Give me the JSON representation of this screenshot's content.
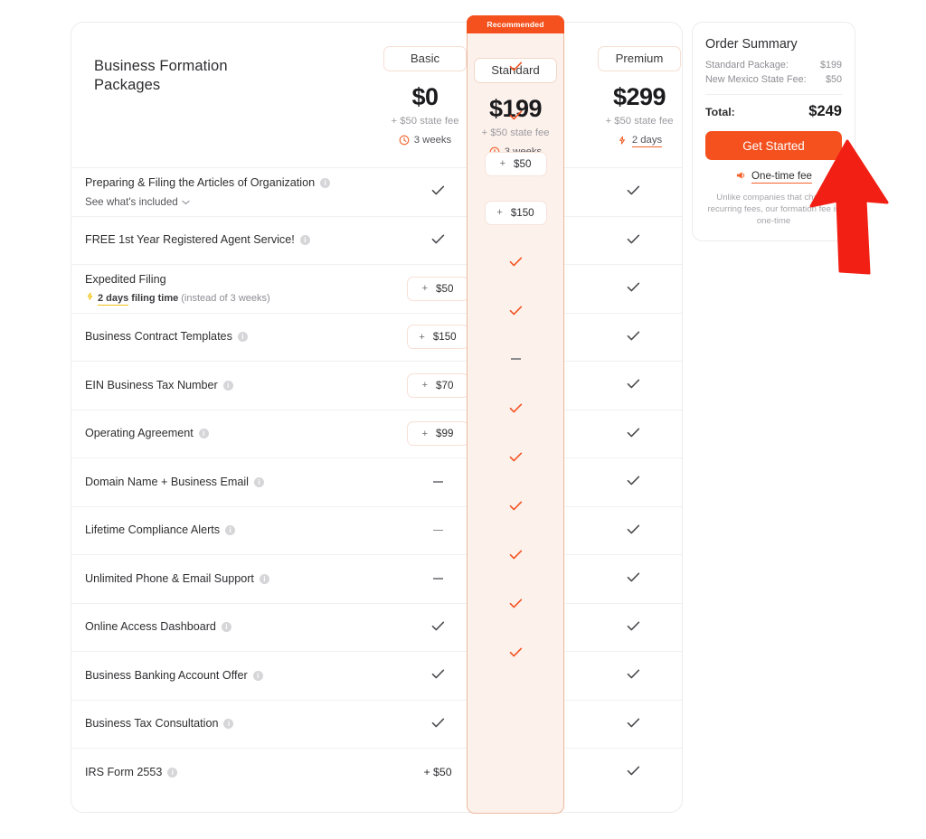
{
  "card": {
    "title": "Business Formation\nPackages",
    "title_line1": "Business Formation",
    "title_line2": "Packages"
  },
  "plans": [
    {
      "key": "basic",
      "name": "Basic",
      "price": "$0",
      "state_fee_note": "+ $50 state fee",
      "turnaround": "3 weeks",
      "turnaround_icon": "clock-icon",
      "recommended": false,
      "badge": ""
    },
    {
      "key": "standard",
      "name": "Standard",
      "price": "$199",
      "state_fee_note": "+ $50 state fee",
      "turnaround": "3 weeks",
      "turnaround_icon": "clock-icon",
      "recommended": true,
      "badge": "Recommended"
    },
    {
      "key": "premium",
      "name": "Premium",
      "price": "$299",
      "state_fee_note": "+ $50 state fee",
      "turnaround": "2 days",
      "turnaround_icon": "lightning-icon",
      "recommended": false,
      "badge": ""
    }
  ],
  "features": [
    {
      "label": "Preparing & Filing the Articles of Organization",
      "info": true,
      "sub_link": "See what's included",
      "sub_link_icon": "chevron-down-icon",
      "basic": {
        "type": "check"
      },
      "standard": {
        "type": "check"
      },
      "premium": {
        "type": "check"
      }
    },
    {
      "label": "FREE 1st Year Registered Agent Service!",
      "info": true,
      "basic": {
        "type": "check"
      },
      "standard": {
        "type": "check"
      },
      "premium": {
        "type": "check"
      }
    },
    {
      "label": "Expedited Filing",
      "info": false,
      "sub_note_icon": "lightning-icon",
      "sub_note_bold": "2 days",
      "sub_note_bold_tail": " filing time",
      "sub_note_muted": "(instead of 3 weeks)",
      "basic": {
        "type": "addon",
        "plus": "+",
        "price": "$50"
      },
      "standard": {
        "type": "addon",
        "plus": "+",
        "price": "$50"
      },
      "premium": {
        "type": "check"
      }
    },
    {
      "label": "Business Contract Templates",
      "info": true,
      "basic": {
        "type": "addon",
        "plus": "+",
        "price": "$150"
      },
      "standard": {
        "type": "addon",
        "plus": "+",
        "price": "$150"
      },
      "premium": {
        "type": "check"
      }
    },
    {
      "label": "EIN Business Tax Number",
      "info": true,
      "basic": {
        "type": "addon",
        "plus": "+",
        "price": "$70"
      },
      "standard": {
        "type": "check"
      },
      "premium": {
        "type": "check"
      }
    },
    {
      "label": "Operating Agreement",
      "info": true,
      "basic": {
        "type": "addon",
        "plus": "+",
        "price": "$99"
      },
      "standard": {
        "type": "check"
      },
      "premium": {
        "type": "check"
      }
    },
    {
      "label": "Domain Name + Business Email",
      "info": true,
      "basic": {
        "type": "dash"
      },
      "standard": {
        "type": "dash"
      },
      "premium": {
        "type": "check"
      }
    },
    {
      "label": "Lifetime Compliance Alerts",
      "info": true,
      "basic": {
        "type": "dash"
      },
      "standard": {
        "type": "check"
      },
      "premium": {
        "type": "check"
      }
    },
    {
      "label": "Unlimited Phone & Email Support",
      "info": true,
      "basic": {
        "type": "dash"
      },
      "standard": {
        "type": "check"
      },
      "premium": {
        "type": "check"
      }
    },
    {
      "label": "Online Access Dashboard",
      "info": true,
      "basic": {
        "type": "check"
      },
      "standard": {
        "type": "check"
      },
      "premium": {
        "type": "check"
      }
    },
    {
      "label": "Business Banking Account Offer",
      "info": true,
      "basic": {
        "type": "check"
      },
      "standard": {
        "type": "check"
      },
      "premium": {
        "type": "check"
      }
    },
    {
      "label": "Business Tax Consultation",
      "info": true,
      "basic": {
        "type": "check"
      },
      "standard": {
        "type": "check"
      },
      "premium": {
        "type": "check"
      }
    },
    {
      "label": "IRS Form 2553",
      "info": true,
      "basic": {
        "type": "text",
        "text": "+ $50"
      },
      "standard": {
        "type": "check"
      },
      "premium": {
        "type": "check"
      }
    }
  ],
  "order_summary": {
    "title": "Order Summary",
    "lines": [
      {
        "label": "Standard Package:",
        "value": "$199"
      },
      {
        "label": "New Mexico State Fee:",
        "value": "$50"
      }
    ],
    "total_label": "Total:",
    "total_value": "$249",
    "cta_label": "Get Started",
    "onetime_label": "One-time fee",
    "onetime_icon": "megaphone-icon",
    "fineprint": "Unlike companies that charge recurring fees, our formation fee is one-time"
  },
  "colors": {
    "accent": "#f4511e",
    "accent_soft": "#fdf1ec",
    "accent_border": "#ecb99e",
    "check_gray": "#4a4a4f",
    "gold": "#f0c419",
    "cursor_red": "#f21f14"
  }
}
